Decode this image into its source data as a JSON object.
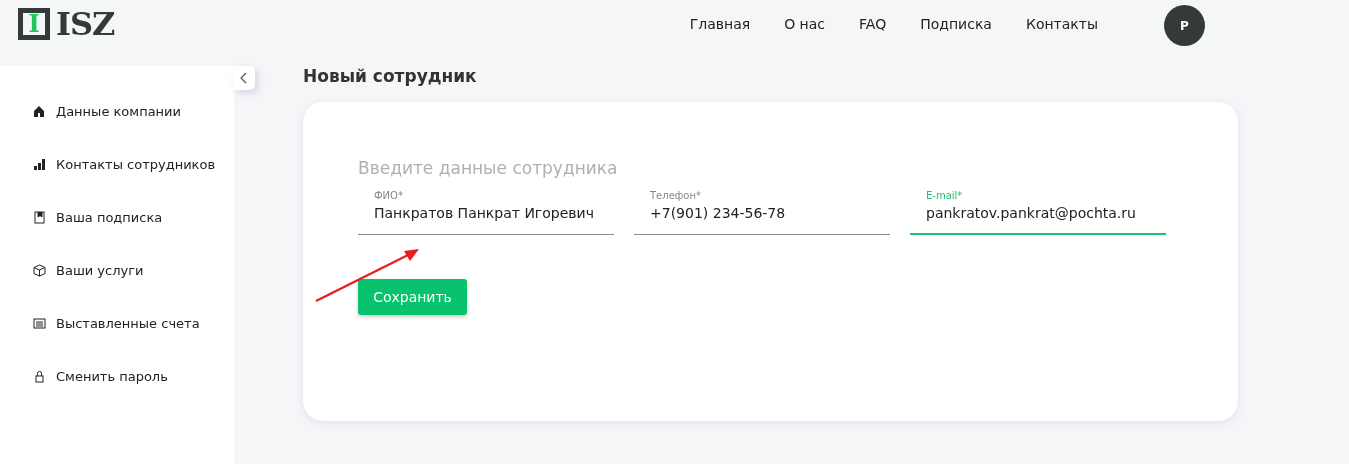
{
  "logo": {
    "mark": "I",
    "name": "ISZ"
  },
  "nav": [
    {
      "label": "Главная"
    },
    {
      "label": "О нас"
    },
    {
      "label": "FAQ"
    },
    {
      "label": "Подписка"
    },
    {
      "label": "Контакты"
    }
  ],
  "avatar": {
    "initial": "P"
  },
  "sidebar": {
    "items": [
      {
        "kind": "home",
        "label": "Данные компании"
      },
      {
        "kind": "bars",
        "label": "Контакты сотрудников"
      },
      {
        "kind": "notebook",
        "label": "Ваша подписка"
      },
      {
        "kind": "cube",
        "label": "Ваши услуги"
      },
      {
        "kind": "list",
        "label": "Выставленные счета"
      },
      {
        "kind": "lock",
        "label": "Сменить пароль"
      }
    ]
  },
  "page_title": "Новый сотрудник",
  "form": {
    "heading": "Введите данные сотрудника",
    "fields": [
      {
        "label": "ФИО*",
        "value": "Панкратов Панкрат Игоревич",
        "focused": false
      },
      {
        "label": "Телефон*",
        "value": "+7(901) 234-56-78",
        "focused": false
      },
      {
        "label": "E-mail*",
        "value": "pankratov.pankrat@pochta.ru",
        "focused": true
      }
    ],
    "submit": "Сохранить"
  }
}
